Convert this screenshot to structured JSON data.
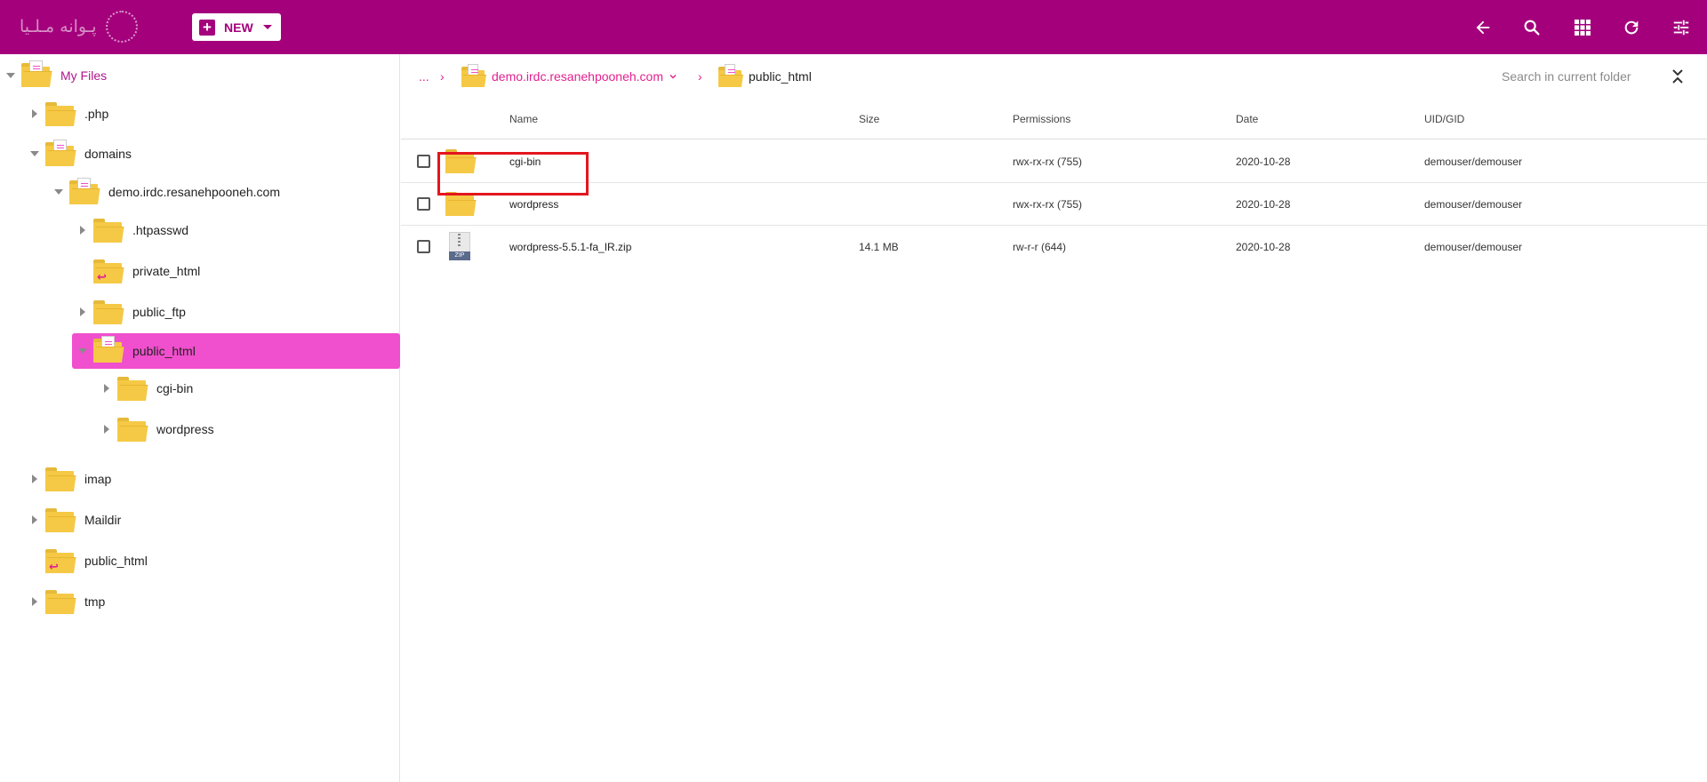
{
  "topbar": {
    "logo_text": "پـوانه مـلـیا",
    "new_label": "NEW",
    "icons": [
      "back-arrow-icon",
      "search-icon",
      "grid-view-icon",
      "refresh-icon",
      "settings-sliders-icon"
    ]
  },
  "colors": {
    "topbar": "#a4007c",
    "accent": "#e2208f",
    "selected": "#f04fcd",
    "folder": "#f5c945",
    "highlight": "#e3161e"
  },
  "tree": {
    "root": "My Files",
    "php": ".php",
    "domains": "domains",
    "demo": "demo.irdc.resanehpooneh.com",
    "htpasswd": ".htpasswd",
    "private_html": "private_html",
    "public_ftp": "public_ftp",
    "public_html": "public_html",
    "cgi_bin": "cgi-bin",
    "wordpress": "wordpress",
    "imap": "imap",
    "maildir": "Maildir",
    "public_html_link": "public_html",
    "tmp": "tmp"
  },
  "breadcrumb": {
    "dots": "...",
    "sep": "›",
    "domain": "demo.irdc.resanehpooneh.com",
    "current": "public_html"
  },
  "search": {
    "placeholder": "Search in current folder"
  },
  "table": {
    "headers": {
      "name": "Name",
      "size": "Size",
      "permissions": "Permissions",
      "date": "Date",
      "uid": "UID/GID"
    },
    "rows": [
      {
        "name": "cgi-bin",
        "size": "",
        "permissions": "rwx-rx-rx (755)",
        "date": "2020-10-28",
        "uid": "demouser/demouser",
        "type": "folder"
      },
      {
        "name": "wordpress",
        "size": "",
        "permissions": "rwx-rx-rx (755)",
        "date": "2020-10-28",
        "uid": "demouser/demouser",
        "type": "folder"
      },
      {
        "name": "wordpress-5.5.1-fa_IR.zip",
        "size": "14.1 MB",
        "permissions": "rw-r-r (644)",
        "date": "2020-10-28",
        "uid": "demouser/demouser",
        "type": "zip",
        "icon_tag": "ZIP"
      }
    ]
  }
}
